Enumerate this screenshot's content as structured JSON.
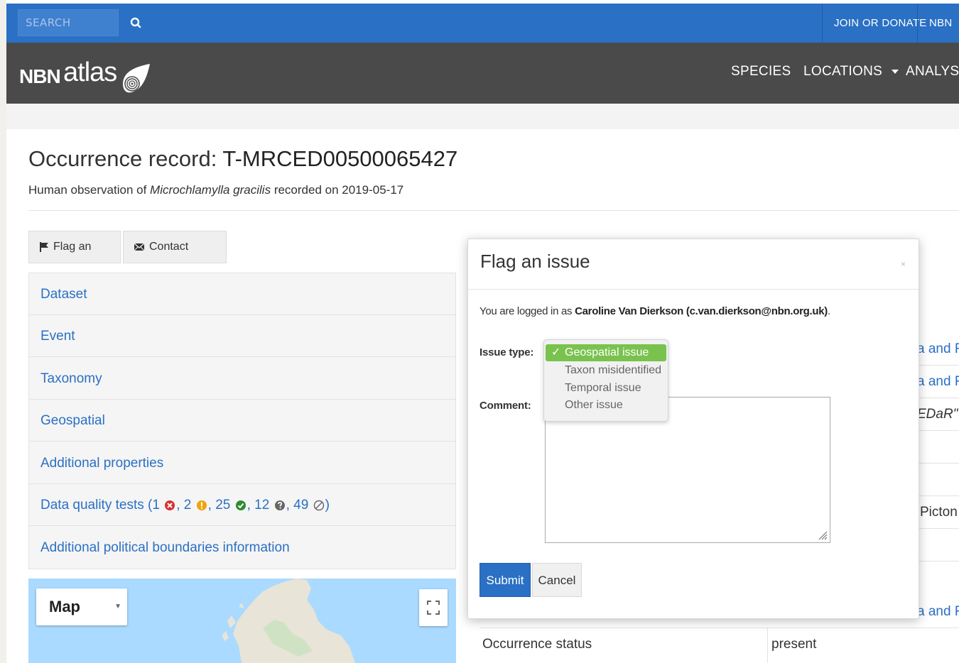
{
  "topbar": {
    "search_placeholder": "SEARCH",
    "join_label": "JOIN OR DONATE",
    "nbn_label": "NBN AT"
  },
  "nav": {
    "logo_nbn": "NBN",
    "logo_atlas": "atlas",
    "species": "SPECIES",
    "locations": "LOCATIONS",
    "analyse": "ANALYSE"
  },
  "record": {
    "title_prefix": "Occurrence record: ",
    "record_id": "T-MRCED00500065427",
    "subtitle_pre": "Human observation of ",
    "species": "Microchlamylla gracilis",
    "subtitle_post": " recorded on 2019-05-17"
  },
  "actions": {
    "flag_label": "Flag an issue",
    "contact_label": "Contact curator"
  },
  "accordion": {
    "items": [
      "Dataset",
      "Event",
      "Taxonomy",
      "Geospatial",
      "Additional properties"
    ],
    "dq_prefix": "Data quality tests (",
    "dq_fail": "1",
    "dq_warn": "2",
    "dq_pass": "25",
    "dq_unknown": "12",
    "dq_na": "49",
    "dq_suffix": ")",
    "political": "Additional political boundaries information"
  },
  "map": {
    "type_label": "Map"
  },
  "background_table": {
    "link1": "a and Re",
    "link2": "a and Re",
    "italic_text": "EDaR\"",
    "picton": "Picton",
    "link3": "a and Re",
    "occurrence_status_label": "Occurrence status",
    "occurrence_status_value": "present"
  },
  "modal": {
    "title": "Flag an issue",
    "close": "×",
    "logged_prefix": "You are logged in as ",
    "user": "Caroline Van Dierkson (c.van.dierkson@nbn.org.uk)",
    "logged_suffix": ".",
    "issue_type_label": "Issue type:",
    "comment_label": "Comment:",
    "issue_options": [
      "Geospatial issue",
      "Taxon misidentified",
      "Temporal issue",
      "Other issue"
    ],
    "selected_check": "✓",
    "submit_label": "Submit",
    "cancel_label": "Cancel"
  },
  "colors": {
    "topbar": "#2a70c4",
    "navbar": "#4a4a4a",
    "link": "#2a70c4",
    "selected_option": "#79c24e",
    "map_water": "#aadaff"
  }
}
